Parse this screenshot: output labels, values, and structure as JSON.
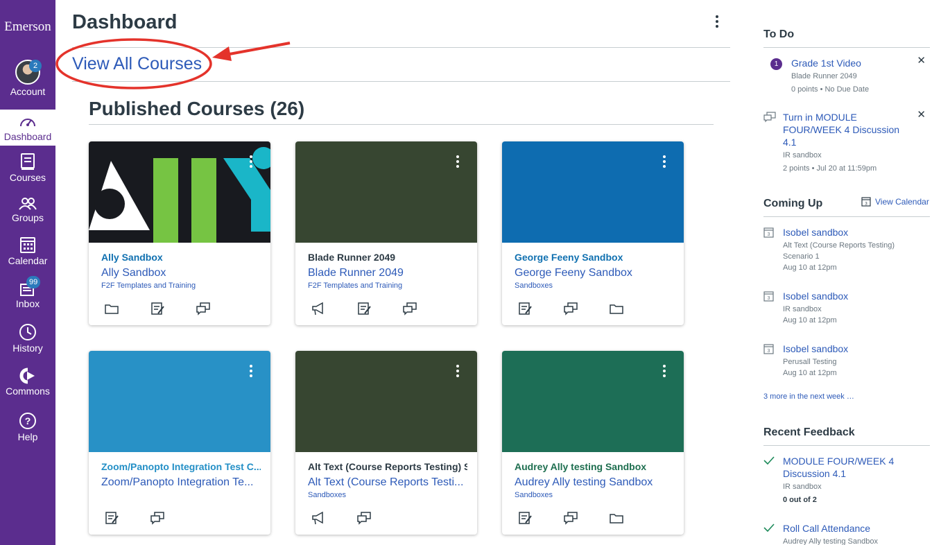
{
  "nav": {
    "brand": "Emerson",
    "account_label": "Account",
    "account_badge": "2",
    "dashboard_label": "Dashboard",
    "courses_label": "Courses",
    "groups_label": "Groups",
    "calendar_label": "Calendar",
    "inbox_label": "Inbox",
    "inbox_badge": "99",
    "history_label": "History",
    "commons_label": "Commons",
    "help_label": "Help"
  },
  "header": {
    "title": "Dashboard",
    "view_all": "View All Courses"
  },
  "section": {
    "title": "Published Courses (26)"
  },
  "cards": [
    {
      "nick": "Ally Sandbox",
      "name": "Ally Sandbox",
      "term": "F2F Templates and Training",
      "color": "#1070b0",
      "icons": [
        "folder-icon",
        "assignments-icon",
        "discussions-icon"
      ]
    },
    {
      "nick": "Blade Runner 2049",
      "name": "Blade Runner 2049",
      "term": "F2F Templates and Training",
      "color": "#2d3b45",
      "icons": [
        "announcements-icon",
        "assignments-icon",
        "discussions-icon"
      ]
    },
    {
      "nick": "George Feeny Sandbox",
      "name": "George Feeny Sandbox",
      "term": "Sandboxes",
      "color": "#1070b0",
      "icons": [
        "assignments-icon",
        "discussions-icon",
        "folder-icon"
      ]
    },
    {
      "nick": "Zoom/Panopto Integration Test C...",
      "name": "Zoom/Panopto Integration Te...",
      "term": "",
      "color": "#238fc6",
      "icons": [
        "assignments-icon",
        "discussions-icon"
      ]
    },
    {
      "nick": "Alt Text (Course Reports Testing) S...",
      "name": "Alt Text (Course Reports Testi...",
      "term": "Sandboxes",
      "color": "#2d3b45",
      "icons": [
        "announcements-icon",
        "discussions-icon"
      ]
    },
    {
      "nick": "Audrey Ally testing Sandbox",
      "name": "Audrey Ally testing Sandbox",
      "term": "Sandboxes",
      "color": "#1d6e4f",
      "icons": [
        "assignments-icon",
        "discussions-icon",
        "folder-icon"
      ]
    }
  ],
  "hero_colors": [
    "#181a1f",
    "#374631",
    "#0e6cb0",
    "#2891c6",
    "#374631",
    "#1d6e56"
  ],
  "todo": {
    "title": "To Do",
    "items": [
      {
        "num": "1",
        "title": "Grade 1st Video",
        "course": "Blade Runner 2049",
        "meta": "0 points • No Due Date"
      },
      {
        "title": "Turn in MODULE FOUR/WEEK 4 Discussion 4.1",
        "course": "IR sandbox",
        "meta": "2 points • Jul 20 at 11:59pm"
      }
    ]
  },
  "coming_up": {
    "title": "Coming Up",
    "view_calendar": "View Calendar",
    "items": [
      {
        "title": "Isobel sandbox",
        "line1": "Alt Text (Course Reports Testing)",
        "line2": "Scenario 1",
        "when": "Aug 10 at 12pm"
      },
      {
        "title": "Isobel sandbox",
        "line1": "IR sandbox",
        "when": "Aug 10 at 12pm"
      },
      {
        "title": "Isobel sandbox",
        "line1": "Perusall Testing",
        "when": "Aug 10 at 12pm"
      }
    ],
    "more": "3 more in the next week …"
  },
  "feedback": {
    "title": "Recent Feedback",
    "items": [
      {
        "title": "MODULE FOUR/WEEK 4 Discussion 4.1",
        "course": "IR sandbox",
        "score": "0 out of 2"
      },
      {
        "title": "Roll Call Attendance",
        "course": "Audrey Ally testing Sandbox"
      }
    ]
  }
}
